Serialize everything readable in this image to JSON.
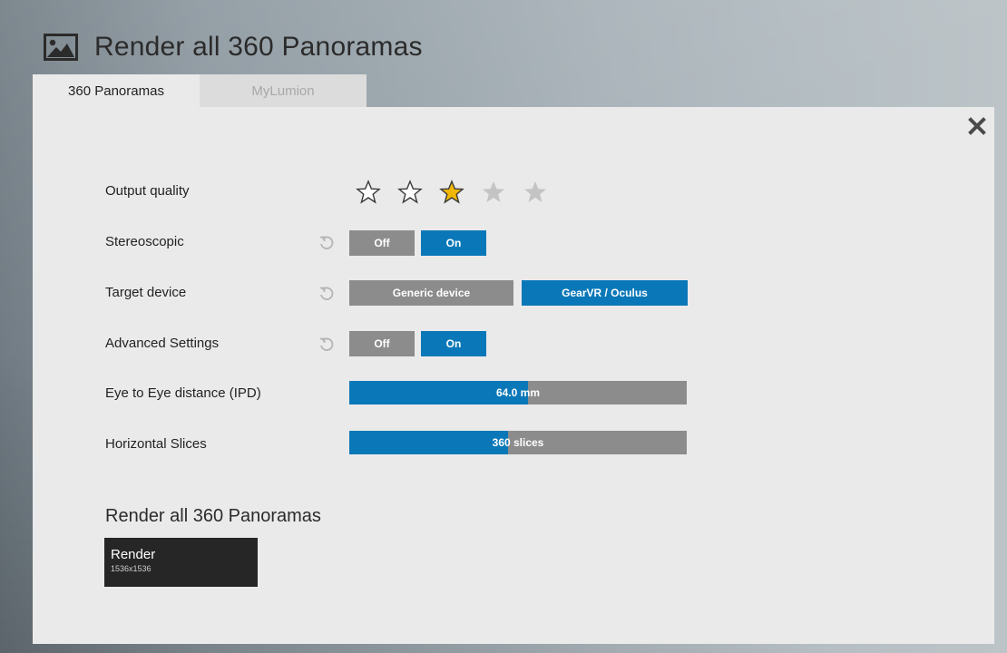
{
  "window": {
    "title": "Render all 360 Panoramas",
    "icon": "image-icon"
  },
  "tabs": [
    {
      "label": "360 Panoramas",
      "active": true
    },
    {
      "label": "MyLumion",
      "active": false
    }
  ],
  "close_icon": "close-icon",
  "settings": {
    "output_quality": {
      "label": "Output quality",
      "rating": 3,
      "max": 5
    },
    "stereoscopic": {
      "label": "Stereoscopic",
      "off_label": "Off",
      "on_label": "On",
      "selected": "On"
    },
    "target_device": {
      "label": "Target device",
      "options": [
        "Generic device",
        "GearVR / Oculus"
      ],
      "selected": "GearVR / Oculus"
    },
    "advanced": {
      "label": "Advanced Settings",
      "off_label": "Off",
      "on_label": "On",
      "selected": "On"
    },
    "ipd": {
      "label": "Eye to Eye distance (IPD)",
      "value_text": "64.0 mm",
      "fill_fraction": 0.53
    },
    "slices": {
      "label": "Horizontal Slices",
      "value_text": "360 slices",
      "fill_fraction": 0.47
    }
  },
  "render_section": {
    "title": "Render all 360 Panoramas",
    "button_label": "Render",
    "button_sub": "1536x1536"
  },
  "colors": {
    "accent_blue": "#0a78b8",
    "button_grey": "#8c8c8c",
    "star_active": "#f2b705",
    "panel_bg": "#eaeaea",
    "render_bg": "#262626"
  }
}
